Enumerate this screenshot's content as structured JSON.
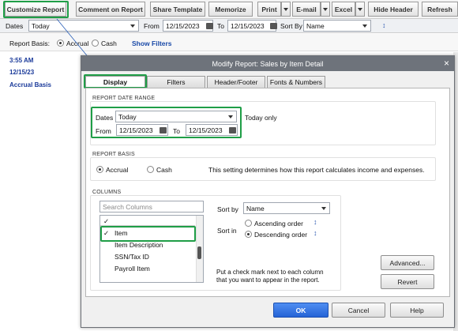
{
  "toolbar": {
    "customize": "Customize Report",
    "comment": "Comment on Report",
    "share": "Share Template",
    "memorize": "Memorize",
    "print": "Print",
    "email": "E-mail",
    "excel": "Excel",
    "hide_header": "Hide Header",
    "refresh": "Refresh"
  },
  "filterbar": {
    "dates_label": "Dates",
    "dates_value": "Today",
    "from_label": "From",
    "from_value": "12/15/2023",
    "to_label": "To",
    "to_value": "12/15/2023",
    "sort_label": "Sort By",
    "sort_value": "Name"
  },
  "basisbar": {
    "label": "Report Basis:",
    "accrual": "Accrual",
    "cash": "Cash",
    "show_filters": "Show Filters"
  },
  "report": {
    "time": "3:55 AM",
    "date": "12/15/23",
    "basis": "Accrual Basis"
  },
  "dialog": {
    "title": "Modify Report: Sales by Item Detail",
    "tabs": [
      "Display",
      "Filters",
      "Header/Footer",
      "Fonts & Numbers"
    ],
    "date_range": {
      "section": "REPORT DATE RANGE",
      "dates_label": "Dates",
      "dates_value": "Today",
      "note": "Today only",
      "from_label": "From",
      "from_value": "12/15/2023",
      "to_label": "To",
      "to_value": "12/15/2023"
    },
    "basis": {
      "section": "REPORT BASIS",
      "accrual": "Accrual",
      "cash": "Cash",
      "note": "This setting determines how this report calculates income and expenses."
    },
    "columns": {
      "section": "COLUMNS",
      "search_placeholder": "Search Columns",
      "header_check": "✓",
      "items": [
        {
          "check": "✓",
          "label": "Item"
        },
        {
          "check": "",
          "label": "Item Description"
        },
        {
          "check": "",
          "label": "SSN/Tax ID"
        },
        {
          "check": "",
          "label": "Payroll Item"
        }
      ],
      "sort_by_label": "Sort by",
      "sort_by_value": "Name",
      "sort_in_label": "Sort in",
      "ascending": "Ascending order",
      "descending": "Descending order",
      "hint": "Put a check mark next to each column that you want to appear in the report."
    },
    "buttons": {
      "advanced": "Advanced...",
      "revert": "Revert",
      "ok": "OK",
      "cancel": "Cancel",
      "help": "Help"
    },
    "close_glyph": "×"
  }
}
